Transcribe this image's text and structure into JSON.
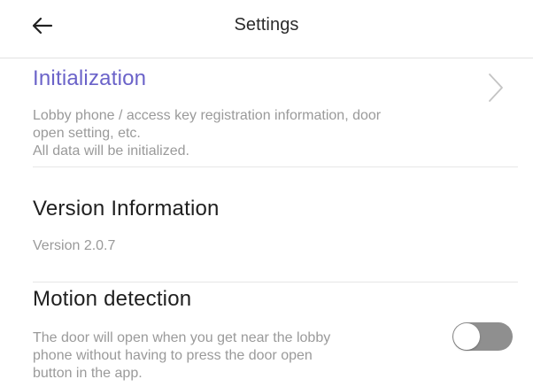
{
  "header": {
    "title": "Settings",
    "back_icon": "arrow-left-icon"
  },
  "initialization": {
    "title": "Initialization",
    "description_line1": "Lobby phone / access key registration information, door",
    "description_line2": "open setting, etc.",
    "description_line3": "All data will be initialized.",
    "chevron_icon": "chevron-right-icon"
  },
  "version": {
    "title": "Version Information",
    "value": "Version 2.0.7"
  },
  "motion_detection": {
    "title": "Motion detection",
    "description_line1": "The door will open when you get near the lobby",
    "description_line2": "phone without having to press the door open",
    "description_line3": "button in the app.",
    "toggle_on": false
  },
  "colors": {
    "accent": "#6b63c9",
    "text": "#1f1f1f",
    "secondary_text": "#9a9a9a",
    "toggle_off": "#8f8f8f"
  }
}
